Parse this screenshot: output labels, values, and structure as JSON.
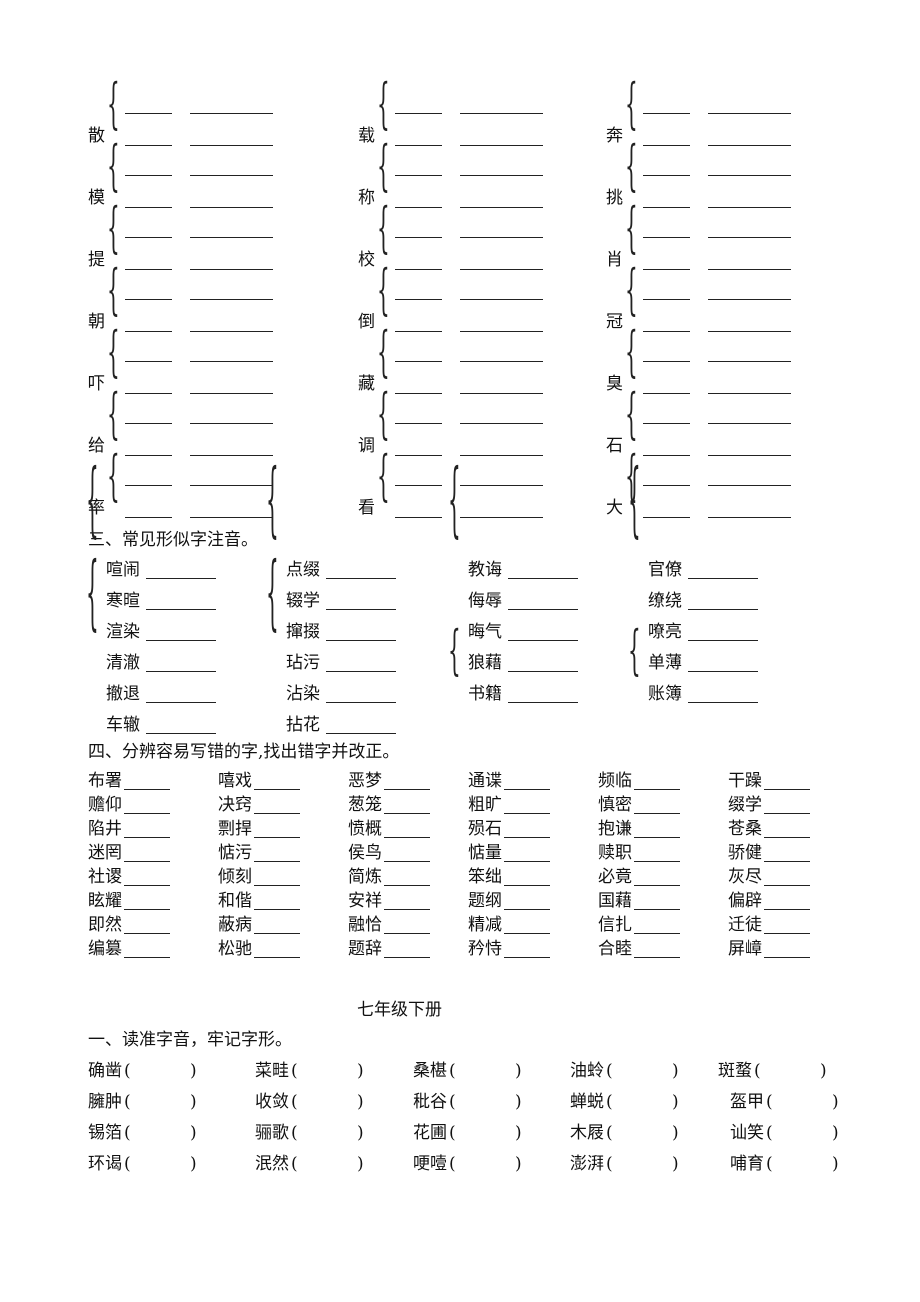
{
  "polyphones": [
    "散",
    "载",
    "奔",
    "模",
    "称",
    "挑",
    "提",
    "校",
    "肖",
    "朝",
    "倒",
    "冠",
    "吓",
    "藏",
    "臭",
    "给",
    "调",
    "石",
    "率",
    "看",
    "大"
  ],
  "section3": {
    "heading": "三、常见形似字注音。",
    "groups_top": [
      [
        "喧闹",
        "寒暄",
        "渲染"
      ],
      [
        "点缀",
        "辍学",
        "撺掇"
      ],
      [
        "教诲",
        "侮辱",
        "晦气"
      ],
      [
        "官僚",
        "缭绕",
        "嘹亮"
      ]
    ],
    "groups_bottom": [
      [
        "清澈",
        "撤退",
        "车辙"
      ],
      [
        "玷污",
        "沾染",
        "拈花"
      ],
      [
        "狼藉",
        "书籍"
      ],
      [
        "单薄",
        "账簿"
      ]
    ]
  },
  "section4": {
    "heading": "四、分辨容易写错的字,找出错字并改正。",
    "rows": [
      [
        "布署",
        "嘻戏",
        "恶梦",
        "通谍",
        "频临",
        "干躁"
      ],
      [
        "赡仰",
        "决窍",
        "葱笼",
        "粗旷",
        "慎密",
        "缀学"
      ],
      [
        "陷井",
        "剽捍",
        "愤概",
        "殒石",
        "抱谦",
        "苍桑"
      ],
      [
        "迷罔",
        "惦污",
        "侯鸟",
        "惦量",
        "赎职",
        "骄健"
      ],
      [
        "社谡",
        "倾刻",
        "简炼",
        "笨绌",
        "必竟",
        "灰尽"
      ],
      [
        "眩耀",
        "和偕",
        "安祥",
        "题纲",
        "国藉",
        "偏辟"
      ],
      [
        "即然",
        "蔽病",
        "融恰",
        "精减",
        "信扎",
        "迁徒"
      ],
      [
        "编篡",
        "松驰",
        "题辞",
        "矜恃",
        "合睦",
        "屏嶂"
      ]
    ]
  },
  "grade": {
    "title": "七年级下册",
    "heading": "一、读准字音，牢记字形。",
    "rows": [
      [
        "确凿",
        "菜畦",
        "桑椹",
        "油蛉",
        "斑蝥"
      ],
      [
        "臃肿",
        "收敛",
        "秕谷",
        "蝉蜕",
        "盔甲"
      ],
      [
        "锡箔",
        "骊歌",
        "花圃",
        "木屐",
        "讪笑"
      ],
      [
        "环谒",
        "泯然",
        "哽噎",
        "澎湃",
        "哺育"
      ]
    ]
  }
}
